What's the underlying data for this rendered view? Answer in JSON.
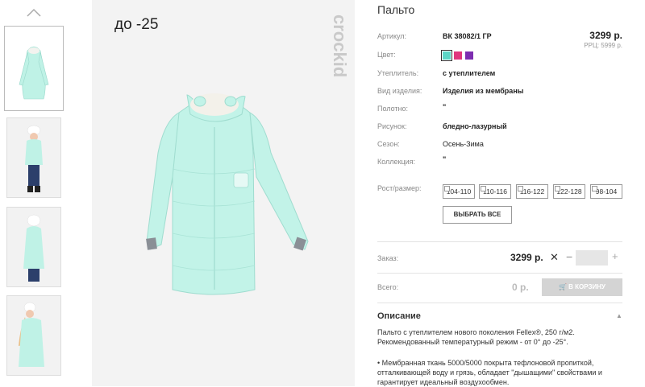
{
  "product": {
    "title": "Пальто",
    "promo": "до -25",
    "brand": "crockid",
    "price": "3299 р.",
    "rrc": "РРЦ: 5999 р."
  },
  "attributes": [
    {
      "label": "Артикул:",
      "value": "ВК 38082/1 ГР"
    },
    {
      "label": "Цвет:",
      "value": ""
    },
    {
      "label": "Утеплитель:",
      "value": "с утеплителем"
    },
    {
      "label": "Вид изделия:",
      "value": "Изделия из мембраны"
    },
    {
      "label": "Полотно:",
      "value": "\""
    },
    {
      "label": "Рисунок:",
      "value": "бледно-лазурный"
    },
    {
      "label": "Сезон:",
      "value": "Осень-Зима"
    },
    {
      "label": "Коллекция:",
      "value": "\""
    },
    {
      "label": "Рост/размер:",
      "value": ""
    }
  ],
  "colors": [
    "#5dd6c7",
    "#e0367d",
    "#7d2db0"
  ],
  "sizes": [
    "104-110",
    "110-116",
    "116-122",
    "122-128",
    "98-104"
  ],
  "select_all": "ВЫБРАТЬ ВСЕ",
  "order": {
    "label": "Заказ:",
    "price": "3299 р.",
    "quantity": "",
    "total_label": "Всего:",
    "total": "0 р.",
    "cart_button": "В КОРЗИНУ"
  },
  "description": {
    "heading": "Описание",
    "para1": "Пальто с утеплителем нового поколения Fellex®, 250 г/м2. Рекомендованный температурный режим - от 0° до -25°.",
    "para2": "• Мембранная ткань 5000/5000 покрыта тефлоновой пропиткой, отталкивающей воду и грязь, обладает \"дышащими\" свойствами и гарантирует идеальный воздухообмен."
  },
  "icons": {
    "thumbs_prev": "chevron-up-icon",
    "cart": "cart-icon",
    "remove": "close-icon",
    "collapse": "caret-up-icon"
  },
  "coat_color": "#bff2e6"
}
